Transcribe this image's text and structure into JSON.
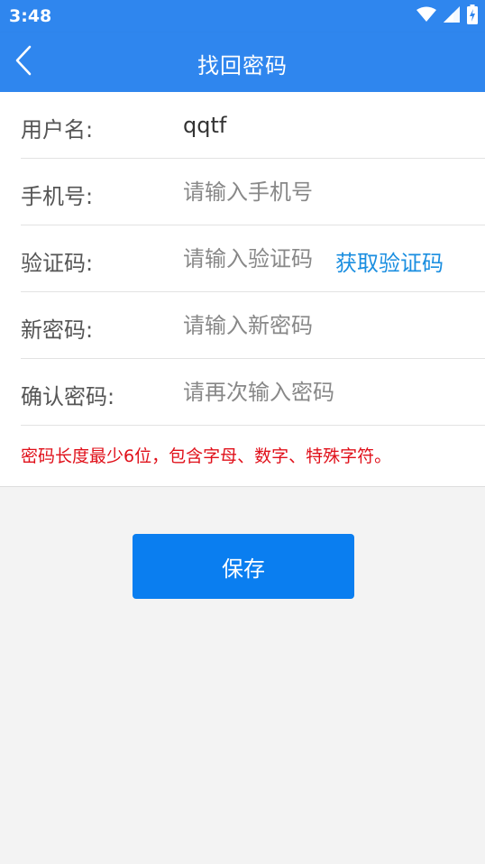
{
  "status_bar": {
    "time": "3:48",
    "icons": [
      "wifi-icon",
      "signal-icon",
      "battery-icon"
    ]
  },
  "app_bar": {
    "title": "找回密码",
    "back_icon": "chevron-left-icon"
  },
  "form": {
    "username": {
      "label": "用户名:",
      "value": "qqtf"
    },
    "phone": {
      "label": "手机号:",
      "placeholder": "请输入手机号"
    },
    "code": {
      "label": "验证码:",
      "placeholder": "请输入验证码",
      "action": "获取验证码"
    },
    "new_password": {
      "label": "新密码:",
      "placeholder": "请输入新密码"
    },
    "confirm_password": {
      "label": "确认密码:",
      "placeholder": "请再次输入密码"
    },
    "hint": "密码长度最少6位，包含字母、数字、特殊字符。"
  },
  "save_button": {
    "label": "保存"
  },
  "colors": {
    "primary": "#2f86ee",
    "button": "#0a7ef0",
    "link": "#1a8ee0",
    "hint": "#e0101a",
    "background": "#f3f3f3"
  }
}
